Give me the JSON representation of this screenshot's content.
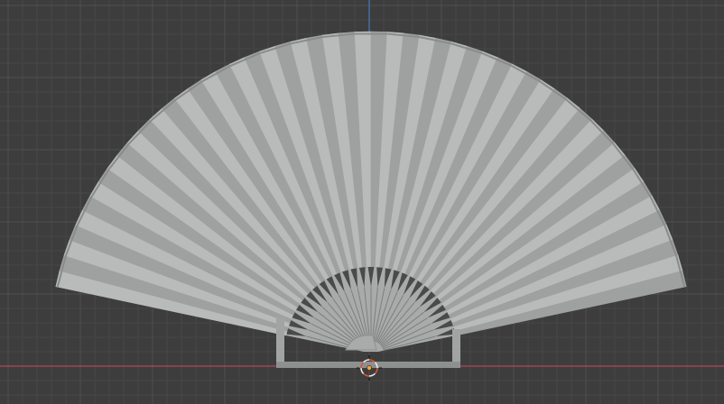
{
  "viewport": {
    "background_color": "#3d3d3d",
    "grid_minor_color": "#474747",
    "grid_major_color": "#505050",
    "x_axis_color": "#b3475a",
    "y_axis_color": "#4a78b8"
  },
  "object": {
    "name_icon": "folding-fan-mesh",
    "rib_count": 27,
    "leaf_light_color": "#b9bbbb",
    "leaf_dark_color": "#9fa1a1",
    "leaf_edge_color": "#8a8c8c",
    "hub_color": "#a9abab",
    "stand_color": "#a2a4a4",
    "stand_shadow_color": "#8e9090"
  },
  "origin_marker": {
    "icon": "3d-cursor-icon",
    "ring_color_a": "#e6e6e6",
    "ring_color_b": "#d2553a",
    "center_color": "#f2a33a"
  }
}
